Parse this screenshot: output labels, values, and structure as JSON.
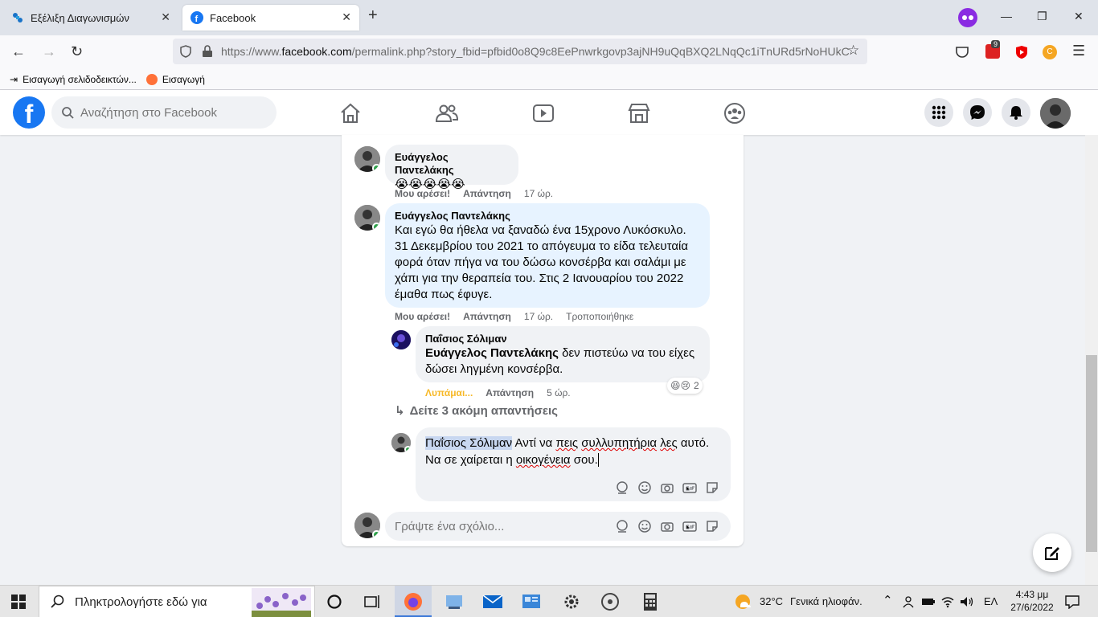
{
  "browser": {
    "tabs": [
      {
        "title": "Εξέλιξη Διαγωνισμών",
        "active": false
      },
      {
        "title": "Facebook",
        "active": true
      }
    ],
    "new_tab": "+",
    "url_prefix": "https://www.",
    "url_domain": "facebook.com",
    "url_path": "/permalink.php?story_fbid=pfbid0o8Q9c8EePnwrkgovp3ajNH9uQqBXQ2LNqQc1iTnURd5rNoHUkC",
    "bookmarks": [
      "Εισαγωγή σελιδοδεικτών...",
      "Εισαγωγή"
    ],
    "extension_badge": "9"
  },
  "facebook": {
    "logo": "f",
    "search_placeholder": "Αναζήτηση στο Facebook",
    "nav": [
      "home-icon",
      "friends-icon",
      "watch-icon",
      "marketplace-icon",
      "groups-icon"
    ],
    "right": [
      "menu-icon",
      "messenger-icon",
      "notifications-icon"
    ]
  },
  "comments": [
    {
      "author": "Ευάγγελος Παντελάκης",
      "text": "😭😭😭😭😭",
      "like": "Μου αρέσει!",
      "reply": "Απάντηση",
      "time": "17 ώρ."
    },
    {
      "author": "Ευάγγελος Παντελάκης",
      "text": "Και εγώ θα ήθελα να ξαναδώ ένα 15χρονο Λυκόσκυλο. 31 Δεκεμβρίου του 2021 το απόγευμα το είδα τελευταία φορά όταν πήγα να του δώσω κονσέρβα και σαλάμι με χάπι για την θεραπεία του. Στις 2 Ιανουαρίου του 2022 έμαθα πως έφυγε.",
      "like": "Μου αρέσει!",
      "reply": "Απάντηση",
      "time": "17 ώρ.",
      "edited": "Τροποποιήθηκε"
    }
  ],
  "reply": {
    "author": "Παΐσιος Σόλιμαν",
    "tag": "Ευάγγελος Παντελάκης",
    "text": " δεν πιστεύω να του είχες δώσει ληγμένη κονσέρβα.",
    "reaction": "Λυπάμαι...",
    "reply": "Απάντηση",
    "time": "5 ώρ.",
    "reaction_emojis": "😆😢",
    "reaction_count": "2"
  },
  "more_replies": "Δείτε 3 ακόμη απαντήσεις",
  "draft": {
    "mention": "Παΐσιος Σόλιμαν",
    "part1": " Αντί να ",
    "w1": "πεις",
    "s1": " ",
    "w2": "συλλυπητήρια",
    "s2": " ",
    "w3": "λες",
    "part2": " αυτό. Να σε χαίρεται η ",
    "w4": "οικογένεια",
    "part3": " σου."
  },
  "comment_placeholder": "Γράψτε ένα σχόλιο...",
  "taskbar": {
    "search_placeholder": "Πληκτρολογήστε εδώ για",
    "weather_temp": "32°C",
    "weather_text": "Γενικά ηλιοφάν.",
    "lang": "ΕΛ",
    "time": "4:43 μμ",
    "date": "27/6/2022"
  }
}
